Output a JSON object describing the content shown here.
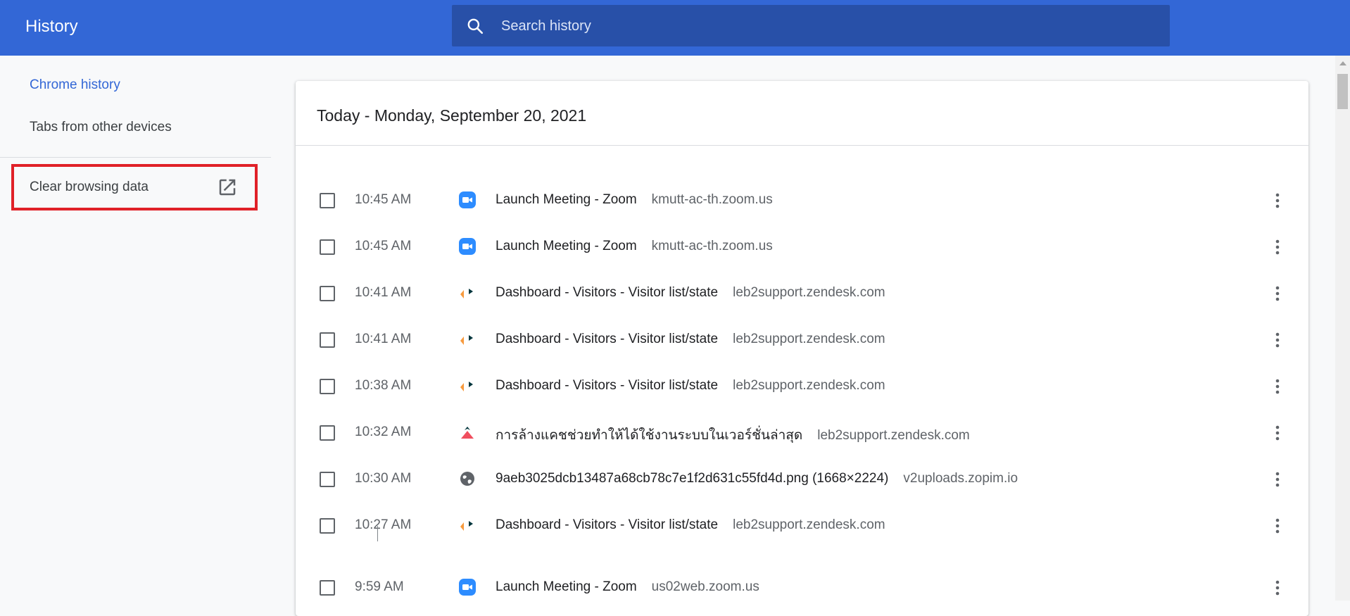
{
  "header": {
    "title": "History",
    "search_placeholder": "Search history"
  },
  "sidebar": {
    "items": [
      {
        "label": "Chrome history",
        "active": true
      },
      {
        "label": "Tabs from other devices",
        "active": false
      }
    ],
    "clear_label": "Clear browsing data"
  },
  "card": {
    "date_header": "Today - Monday, September 20, 2021",
    "entries": [
      {
        "time": "10:45 AM",
        "title": "Launch Meeting - Zoom",
        "domain": "kmutt-ac-th.zoom.us",
        "icon": "zoom-icon"
      },
      {
        "time": "10:45 AM",
        "title": "Launch Meeting - Zoom",
        "domain": "kmutt-ac-th.zoom.us",
        "icon": "zoom-icon"
      },
      {
        "time": "10:41 AM",
        "title": "Dashboard - Visitors - Visitor list/state",
        "domain": "leb2support.zendesk.com",
        "icon": "zendesk-icon"
      },
      {
        "time": "10:41 AM",
        "title": "Dashboard - Visitors - Visitor list/state",
        "domain": "leb2support.zendesk.com",
        "icon": "zendesk-icon"
      },
      {
        "time": "10:38 AM",
        "title": "Dashboard - Visitors - Visitor list/state",
        "domain": "leb2support.zendesk.com",
        "icon": "zendesk-icon"
      },
      {
        "time": "10:32 AM",
        "title": "การล้างแคชช่วยทำให้ได้ใช้งานระบบในเวอร์ชั่นล่าสุด",
        "domain": "leb2support.zendesk.com",
        "icon": "leb2-icon"
      },
      {
        "time": "10:30 AM",
        "title": "9aeb3025dcb13487a68cb78c7e1f2d631c55fd4d.png (1668×2224)",
        "domain": "v2uploads.zopim.io",
        "icon": "globe-icon"
      },
      {
        "time": "10:27 AM",
        "title": "Dashboard - Visitors - Visitor list/state",
        "domain": "leb2support.zendesk.com",
        "icon": "zendesk-icon"
      },
      {
        "time": "9:59 AM",
        "title": "Launch Meeting - Zoom",
        "domain": "us02web.zoom.us",
        "icon": "zoom-icon"
      }
    ]
  },
  "colors": {
    "header_bg": "#3367d6",
    "search_bg": "#2850a8",
    "highlight_box": "#e02128",
    "zoom_blue": "#2d8cff",
    "zendesk_orange": "#f79a3e",
    "zendesk_dark": "#03363d"
  }
}
